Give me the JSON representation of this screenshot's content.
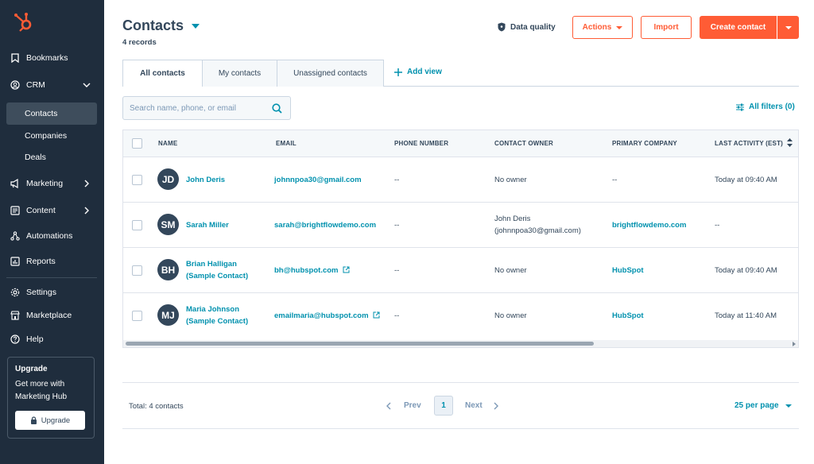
{
  "colors": {
    "sidebar_bg": "#1f2d3d",
    "accent": "#ff5c35",
    "link": "#0091ae",
    "text": "#33475b"
  },
  "sidebar": {
    "bookmarks": "Bookmarks",
    "crm": "CRM",
    "crm_items": {
      "contacts": "Contacts",
      "companies": "Companies",
      "deals": "Deals"
    },
    "marketing": "Marketing",
    "content": "Content",
    "automations": "Automations",
    "reports": "Reports",
    "settings": "Settings",
    "marketplace": "Marketplace",
    "help": "Help",
    "upgrade": {
      "title": "Upgrade",
      "text": "Get more with Marketing Hub",
      "button": "Upgrade"
    }
  },
  "header": {
    "title": "Contacts",
    "records": "4 records",
    "data_quality": "Data quality",
    "actions": "Actions",
    "import": "Import",
    "create": "Create contact"
  },
  "tabs": {
    "all": "All contacts",
    "mine": "My contacts",
    "unassigned": "Unassigned contacts",
    "add_view": "Add view"
  },
  "search": {
    "placeholder": "Search name, phone, or email"
  },
  "filters": "All filters (0)",
  "columns": {
    "name": "NAME",
    "email": "EMAIL",
    "phone": "PHONE NUMBER",
    "owner": "CONTACT OWNER",
    "company": "PRIMARY COMPANY",
    "activity": "LAST ACTIVITY (EST)"
  },
  "rows": [
    {
      "initials": "JD",
      "name": "John Deris",
      "name2": "",
      "email": "johnnpoa30@gmail.com",
      "phone": "--",
      "owner": "No owner",
      "owner2": "",
      "company": "--",
      "activity": "Today at 09:40 AM"
    },
    {
      "initials": "SM",
      "name": "Sarah Miller",
      "name2": "",
      "email": "sarah@brightflowdemo.com",
      "phone": "--",
      "owner": "John Deris",
      "owner2": "(johnnpoa30@gmail.com)",
      "company": "brightflowdemo.com",
      "activity": "--"
    },
    {
      "initials": "BH",
      "name": "Brian Halligan",
      "name2": "(Sample Contact)",
      "email": "bh@hubspot.com",
      "phone": "--",
      "owner": "No owner",
      "owner2": "",
      "company": "HubSpot",
      "activity": "Today at 09:40 AM"
    },
    {
      "initials": "MJ",
      "name": "Maria Johnson",
      "name2": "(Sample Contact)",
      "email": "emailmaria@hubspot.com",
      "phone": "--",
      "owner": "No owner",
      "owner2": "",
      "company": "HubSpot",
      "activity": "Today at 11:40 AM"
    }
  ],
  "footer": {
    "total": "Total: 4 contacts",
    "prev": "Prev",
    "page": "1",
    "next": "Next",
    "per_page": "25 per page"
  }
}
